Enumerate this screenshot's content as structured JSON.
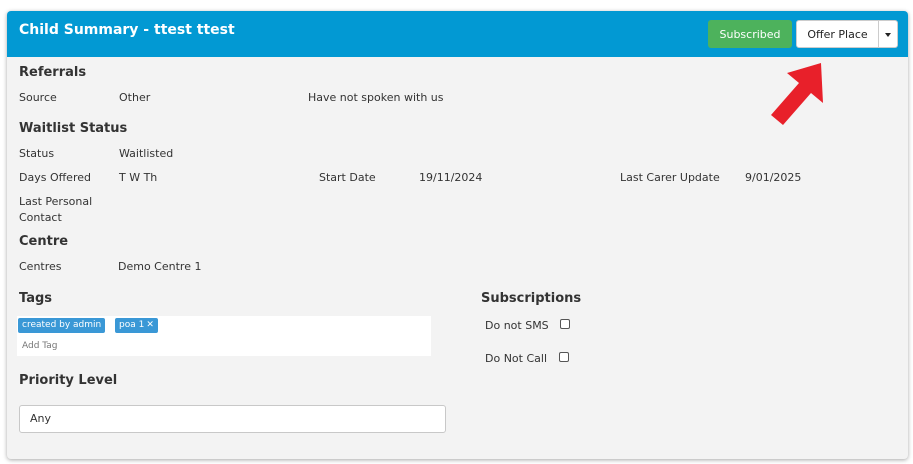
{
  "header": {
    "title": "Child Summary - ttest ttest",
    "subscribed_label": "Subscribed",
    "offer_place_label": "Offer Place"
  },
  "referrals": {
    "heading": "Referrals",
    "source_label": "Source",
    "source_value": "Other",
    "note": "Have not spoken with us"
  },
  "waitlist": {
    "heading": "Waitlist Status",
    "status_label": "Status",
    "status_value": "Waitlisted",
    "days_offered_label": "Days Offered",
    "days_offered_value": "T W Th",
    "start_date_label": "Start Date",
    "start_date_value": "19/11/2024",
    "last_carer_update_label": "Last Carer Update",
    "last_carer_update_value": "9/01/2025",
    "last_personal_contact_label": "Last Personal Contact"
  },
  "centre": {
    "heading": "Centre",
    "centres_label": "Centres",
    "centres_value": "Demo Centre 1"
  },
  "tags": {
    "heading": "Tags",
    "items": [
      "created by admin",
      "poa 1"
    ],
    "remove_glyph": "✕",
    "add_placeholder": "Add Tag"
  },
  "subscriptions": {
    "heading": "Subscriptions",
    "do_not_sms_label": "Do not SMS",
    "do_not_sms_checked": false,
    "do_not_call_label": "Do Not Call",
    "do_not_call_checked": false
  },
  "priority": {
    "heading": "Priority Level",
    "selected_value": "Any"
  },
  "colors": {
    "header_bg": "#0299d3",
    "subscribed_bg": "#4db25c",
    "tag_bg": "#3a98d6",
    "arrow": "#e8202a",
    "card_bg": "#f3f3f3"
  },
  "icons": {
    "caret": "chevron-down-icon",
    "annotation": "red-arrow-icon"
  }
}
